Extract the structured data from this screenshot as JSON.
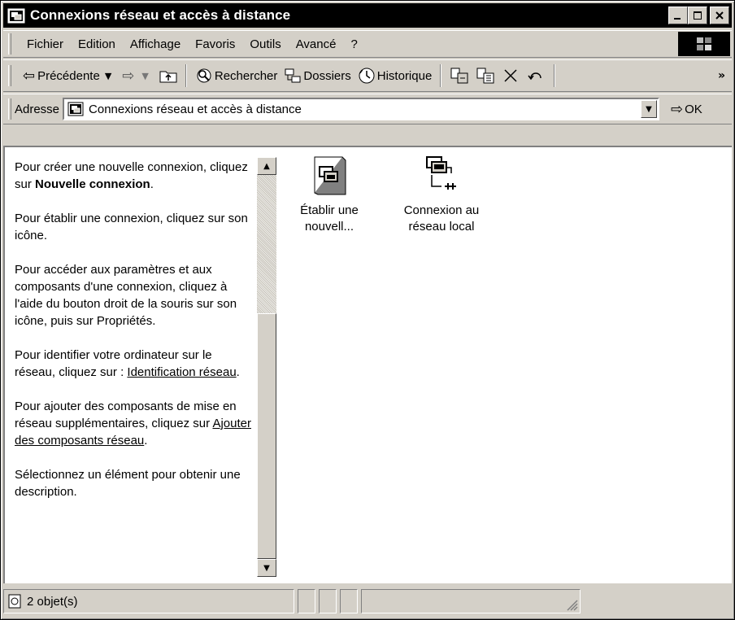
{
  "window": {
    "title": "Connexions réseau et accès à distance",
    "buttons": {
      "minimize": "_",
      "maximize": "□",
      "close": "×"
    }
  },
  "menu": [
    "Fichier",
    "Edition",
    "Affichage",
    "Favoris",
    "Outils",
    "Avancé",
    "?"
  ],
  "toolbar": {
    "back": "Précédente",
    "search": "Rechercher",
    "folders": "Dossiers",
    "history": "Historique",
    "more": "»"
  },
  "address": {
    "label": "Adresse",
    "value": "Connexions réseau et accès à distance",
    "go": "OK"
  },
  "left_pane": {
    "p1_a": "Pour créer une nouvelle connexion, cliquez sur ",
    "p1_bold": "Nouvelle connexion",
    "p1_end": ".",
    "p2": "Pour établir une connexion, cliquez sur son icône.",
    "p3": "Pour accéder aux paramètres et aux composants d'une connexion, cliquez à l'aide du bouton droit de la souris sur son icône, puis sur Propriétés.",
    "p4_a": "Pour identifier votre ordinateur sur le réseau, cliquez sur : ",
    "p4_link": "Identification réseau",
    "p4_end": ".",
    "p5_a": "Pour ajouter des composants de mise en réseau supplémentaires, cliquez sur ",
    "p5_link": "Ajouter des composants réseau",
    "p5_end": ".",
    "p6": "Sélectionnez un élément pour obtenir une description."
  },
  "items": [
    {
      "line1": "Établir une",
      "line2": "nouvell..."
    },
    {
      "line1": "Connexion au",
      "line2": "réseau local"
    }
  ],
  "status": {
    "count": "2 objet(s)"
  }
}
